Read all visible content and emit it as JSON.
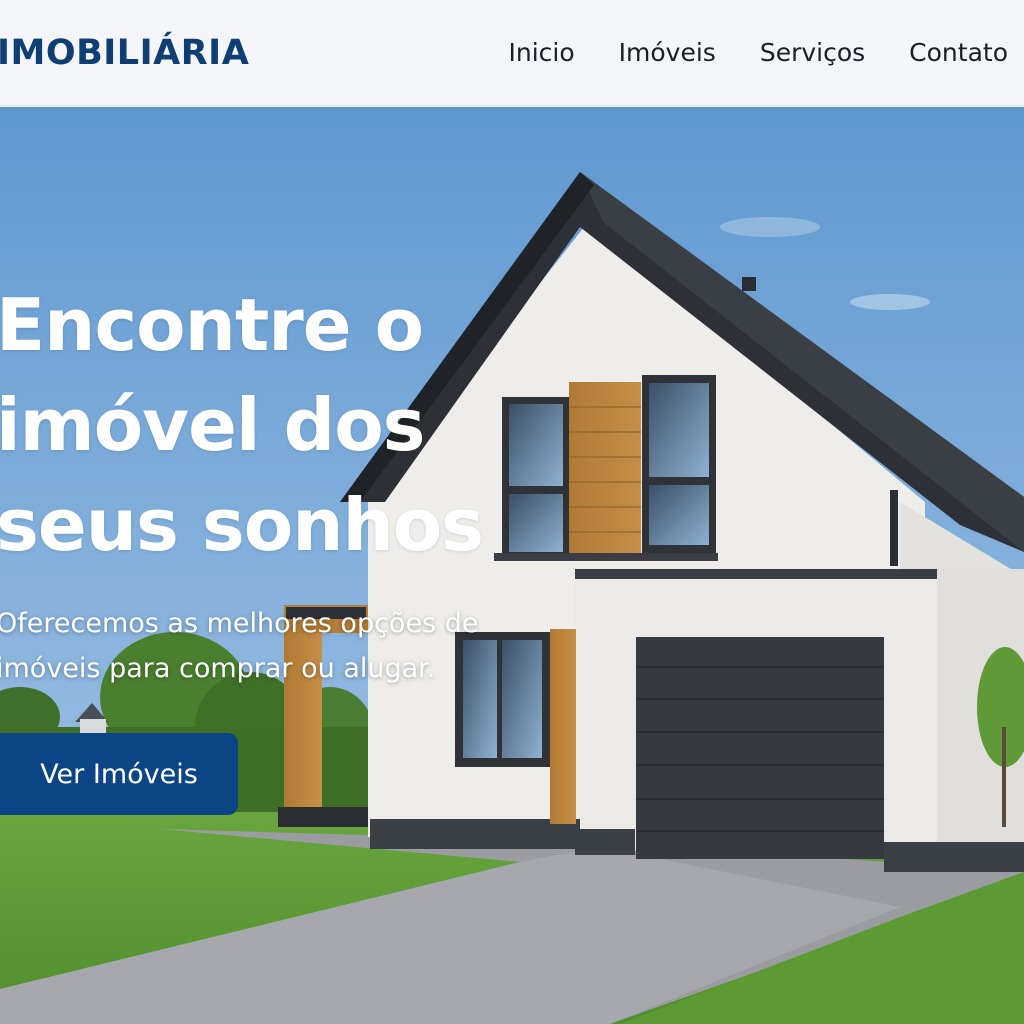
{
  "brand": {
    "name": "IMOBILIÁRIA"
  },
  "nav": {
    "items": [
      {
        "label": "Inicio"
      },
      {
        "label": "Imóveis"
      },
      {
        "label": "Serviços"
      },
      {
        "label": "Contato"
      }
    ]
  },
  "hero": {
    "title": "Encontre o\nimóvel dos\nseus sonhos",
    "subtitle": "Oferecemos as melhores opções de\nimóveis para comprar ou alugar.",
    "cta_label": "Ver Imóveis"
  },
  "colors": {
    "brand": "#0e3e72",
    "cta": "#0c4585",
    "sky": "#6a9fd3",
    "grass": "#5a9a35"
  }
}
